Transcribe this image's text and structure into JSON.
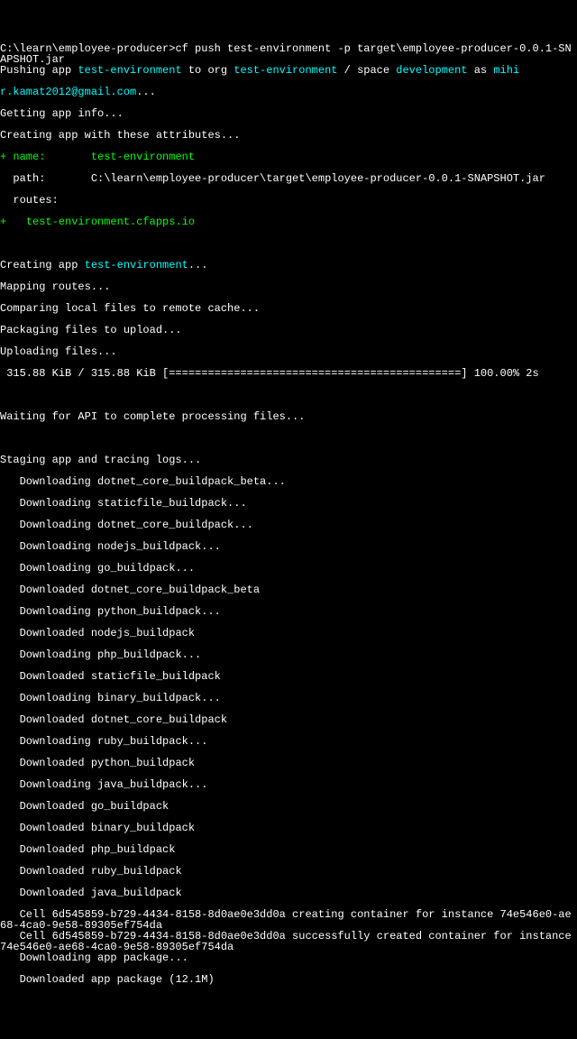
{
  "prompt_path": "C:\\learn\\employee-producer>",
  "command": "cf push test-environment -p target\\employee-producer-0.0.1-SNAPSHOT.jar",
  "push_prefix": "Pushing app ",
  "app_name": "test-environment",
  "push_mid1": " to org ",
  "org_name": "test-environment",
  "push_mid2": " / space ",
  "space_name": "development",
  "push_mid3": " as ",
  "user_part1": "mihi",
  "user_part2": "r.kamat2012@gmail.com",
  "dots": "...",
  "get_info": "Getting app info...",
  "create_attrs": "Creating app with these attributes...",
  "name_prefix": "+ name:       ",
  "name_val": "test-environment",
  "path_line": "  path:       C:\\learn\\employee-producer\\target\\employee-producer-0.0.1-SNAPSHOT.jar",
  "routes_label": "  routes:",
  "route_prefix": "+   ",
  "route_val": "test-environment.cfapps.io",
  "blank": "",
  "creating_prefix": "Creating app ",
  "creating_name": "test-environment",
  "mapping_routes": "Mapping routes...",
  "comparing": "Comparing local files to remote cache...",
  "packaging": "Packaging files to upload...",
  "uploading": "Uploading files...",
  "progress": " 315.88 KiB / 315.88 KiB [=============================================] 100.00% 2s",
  "waiting": "Waiting for API to complete processing files...",
  "staging": "Staging app and tracing logs...",
  "dl1": "   Downloading dotnet_core_buildpack_beta...",
  "dl2": "   Downloading staticfile_buildpack...",
  "dl3": "   Downloading dotnet_core_buildpack...",
  "dl4": "   Downloading nodejs_buildpack...",
  "dl5": "   Downloading go_buildpack...",
  "dl6": "   Downloaded dotnet_core_buildpack_beta",
  "dl7": "   Downloading python_buildpack...",
  "dl8": "   Downloaded nodejs_buildpack",
  "dl9": "   Downloading php_buildpack...",
  "dl10": "   Downloaded staticfile_buildpack",
  "dl11": "   Downloading binary_buildpack...",
  "dl12": "   Downloaded dotnet_core_buildpack",
  "dl13": "   Downloading ruby_buildpack...",
  "dl14": "   Downloaded python_buildpack",
  "dl15": "   Downloading java_buildpack...",
  "dl16": "   Downloaded go_buildpack",
  "dl17": "   Downloaded binary_buildpack",
  "dl18": "   Downloaded php_buildpack",
  "dl19": "   Downloaded ruby_buildpack",
  "dl20": "   Downloaded java_buildpack",
  "cell1": "   Cell 6d545859-b729-4434-8158-8d0ae0e3dd0a creating container for instance 74e546e0-ae68-4ca0-9e58-89305ef754da",
  "cell2": "   Cell 6d545859-b729-4434-8158-8d0ae0e3dd0a successfully created container for instance 74e546e0-ae68-4ca0-9e58-89305ef754da",
  "dlpkg": "   Downloading app package...",
  "dlpkg2": "   Downloaded app package (12.1M)"
}
